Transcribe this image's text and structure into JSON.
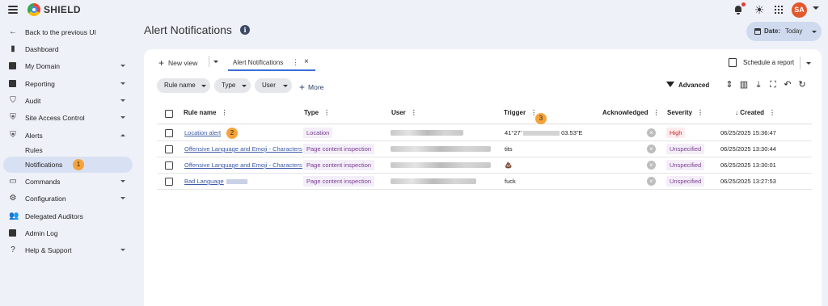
{
  "app": {
    "brand": "SHIELD",
    "avatar_initials": "SA"
  },
  "sidebar": {
    "back_label": "Back to the previous UI",
    "items": [
      {
        "label": "Dashboard",
        "icon": "bar-chart-icon",
        "expandable": false
      },
      {
        "label": "My Domain",
        "icon": "domain-icon",
        "expandable": true
      },
      {
        "label": "Reporting",
        "icon": "report-icon",
        "expandable": true
      },
      {
        "label": "Audit",
        "icon": "audit-icon",
        "expandable": true
      },
      {
        "label": "Site Access Control",
        "icon": "shield-check-icon",
        "expandable": true
      },
      {
        "label": "Alerts",
        "icon": "alert-shield-icon",
        "expandable": true,
        "expanded": true
      },
      {
        "label": "Rules",
        "sub": true
      },
      {
        "label": "Notifications",
        "sub": true,
        "active": true
      },
      {
        "label": "Commands",
        "icon": "commands-icon",
        "expandable": true
      },
      {
        "label": "Configuration",
        "icon": "gear-icon",
        "expandable": true
      },
      {
        "label": "Delegated Auditors",
        "icon": "people-icon",
        "expandable": false
      },
      {
        "label": "Admin Log",
        "icon": "log-icon",
        "expandable": false
      },
      {
        "label": "Help & Support",
        "icon": "help-icon",
        "expandable": true
      }
    ]
  },
  "header": {
    "title": "Alert Notifications",
    "date_label": "Date:",
    "date_value": "Today"
  },
  "toolbar": {
    "new_view": "New view",
    "active_tab": "Alert Notifications",
    "schedule": "Schedule a report",
    "filters": [
      "Rule name",
      "Type",
      "User"
    ],
    "more": "More",
    "advanced": "Advanced"
  },
  "table": {
    "columns": [
      "Rule name",
      "Type",
      "User",
      "Trigger",
      "Acknowledged",
      "Severity",
      "Created"
    ],
    "rows": [
      {
        "rule": "Location alert",
        "type": "Location",
        "trigger": "41°27'",
        "trigger_tail": "03.53\"E",
        "severity": "High",
        "created": "06/25/2025 15:36:47"
      },
      {
        "rule": "Offensive Language and Emoji - Characters c",
        "type": "Page content inspection",
        "trigger": "tits",
        "severity": "Unspecified",
        "created": "06/25/2025 13:30:44"
      },
      {
        "rule": "Offensive Language and Emoji - Characters c",
        "type": "Page content inspection",
        "trigger": "💩",
        "severity": "Unspecified",
        "created": "06/25/2025 13:30:01"
      },
      {
        "rule": "Bad Language",
        "type": "Page content inspection",
        "trigger": "fuck",
        "severity": "Unspecified",
        "created": "06/25/2025 13:27:53"
      }
    ]
  },
  "steps": [
    "1",
    "2",
    "3"
  ],
  "colors": {
    "accent": "#3b6fd4",
    "high": "#c62828",
    "unspecified": "#7a3d93",
    "badge": "#f5a33a",
    "avatar": "#e2572c"
  }
}
